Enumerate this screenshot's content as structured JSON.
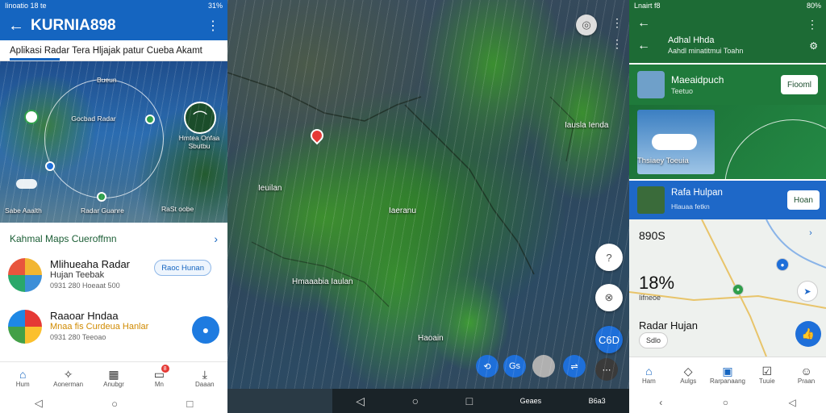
{
  "left_phone": {
    "status": {
      "left": "Iinoatio 18 te",
      "right": "31%"
    },
    "appbar": {
      "title": "KURNIA898"
    },
    "subtitle": "Aplikasi Radar Tera Hljajak patur Cueba Akamt",
    "globe": {
      "label_top": "Bueun",
      "label_center": "Gocbad Radar",
      "label_right": "Hmtea Onfaa Sbutbu",
      "label_bottom_left": "Sabe Aaalth",
      "label_bottom_center": "Radar Guanre",
      "label_bottom_right": "RaSt oobe"
    },
    "sheet": {
      "heading": "Kahmal Maps Cueroffmn",
      "apps": [
        {
          "name": "Mlihueaha Radar",
          "subtitle": "Hujan Teebak",
          "meta": "0931 280   Hoeaat   500",
          "button": "Raoc Hunan",
          "colors": [
            "#f2b632",
            "#3c8fd8",
            "#2aa86a",
            "#e8553d"
          ]
        },
        {
          "name": "Raaoar Hndaa",
          "subtitle": "Mnaa fis Curdeua Hanlar",
          "meta": "0931 280   Teeoao",
          "colors": [
            "#e53935",
            "#fbc02d",
            "#43a047",
            "#1e88e5"
          ]
        }
      ]
    },
    "nav": [
      {
        "label": "Hum",
        "icon": "home-icon",
        "active": true
      },
      {
        "label": "Aonerman",
        "icon": "compass-icon",
        "active": false
      },
      {
        "label": "Anubgr",
        "icon": "calendar-icon",
        "active": false
      },
      {
        "label": "Mn",
        "icon": "inbox-icon",
        "active": false,
        "badge": "8"
      },
      {
        "label": "Daaan",
        "icon": "download-icon",
        "active": false
      }
    ]
  },
  "middle_map": {
    "labels": {
      "west": "Ieuilan",
      "center": "Iaeranu",
      "sw": "Hmaaabia Iaulan",
      "se": "Haoain",
      "ne": "Iausla Ienda"
    },
    "controls": {
      "btn_a": "?",
      "btn_b": "⊗",
      "btn_c": "C6D",
      "layer_labels": [
        "⟲",
        "Gs",
        "",
        "⇌"
      ]
    },
    "sysnav_label": "Geaes",
    "sysnav_right": "B6a3"
  },
  "right_phone": {
    "status": {
      "left": "Lnairt f8",
      "right": "80%"
    },
    "header": {
      "title": "Adhal Hhda",
      "subtitle": "Aahdl minatitmui Toahn"
    },
    "card1": {
      "title": "Maeaidpuch",
      "subtitle": "Teetuo",
      "button": "Fiooml"
    },
    "weather": {
      "label": "Thsiaey Toeuia"
    },
    "radar": {
      "title": "Rafa Hulpan",
      "subtitle": "Hlauaa fetkn",
      "button": "Hoan"
    },
    "map": {
      "top": "890S",
      "percent": "18%",
      "sub": "Iifneoe",
      "radar_label": "Radar Hujan",
      "chip": "Sdlo"
    },
    "nav": [
      {
        "label": "Ham",
        "icon": "home-icon",
        "active": true
      },
      {
        "label": "Aulgs",
        "icon": "map-icon",
        "active": false
      },
      {
        "label": "Rarpanaang",
        "icon": "grid-icon",
        "active": false
      },
      {
        "label": "Tuuie",
        "icon": "check-icon",
        "active": false
      },
      {
        "label": "Praan",
        "icon": "profile-icon",
        "active": false
      }
    ]
  }
}
